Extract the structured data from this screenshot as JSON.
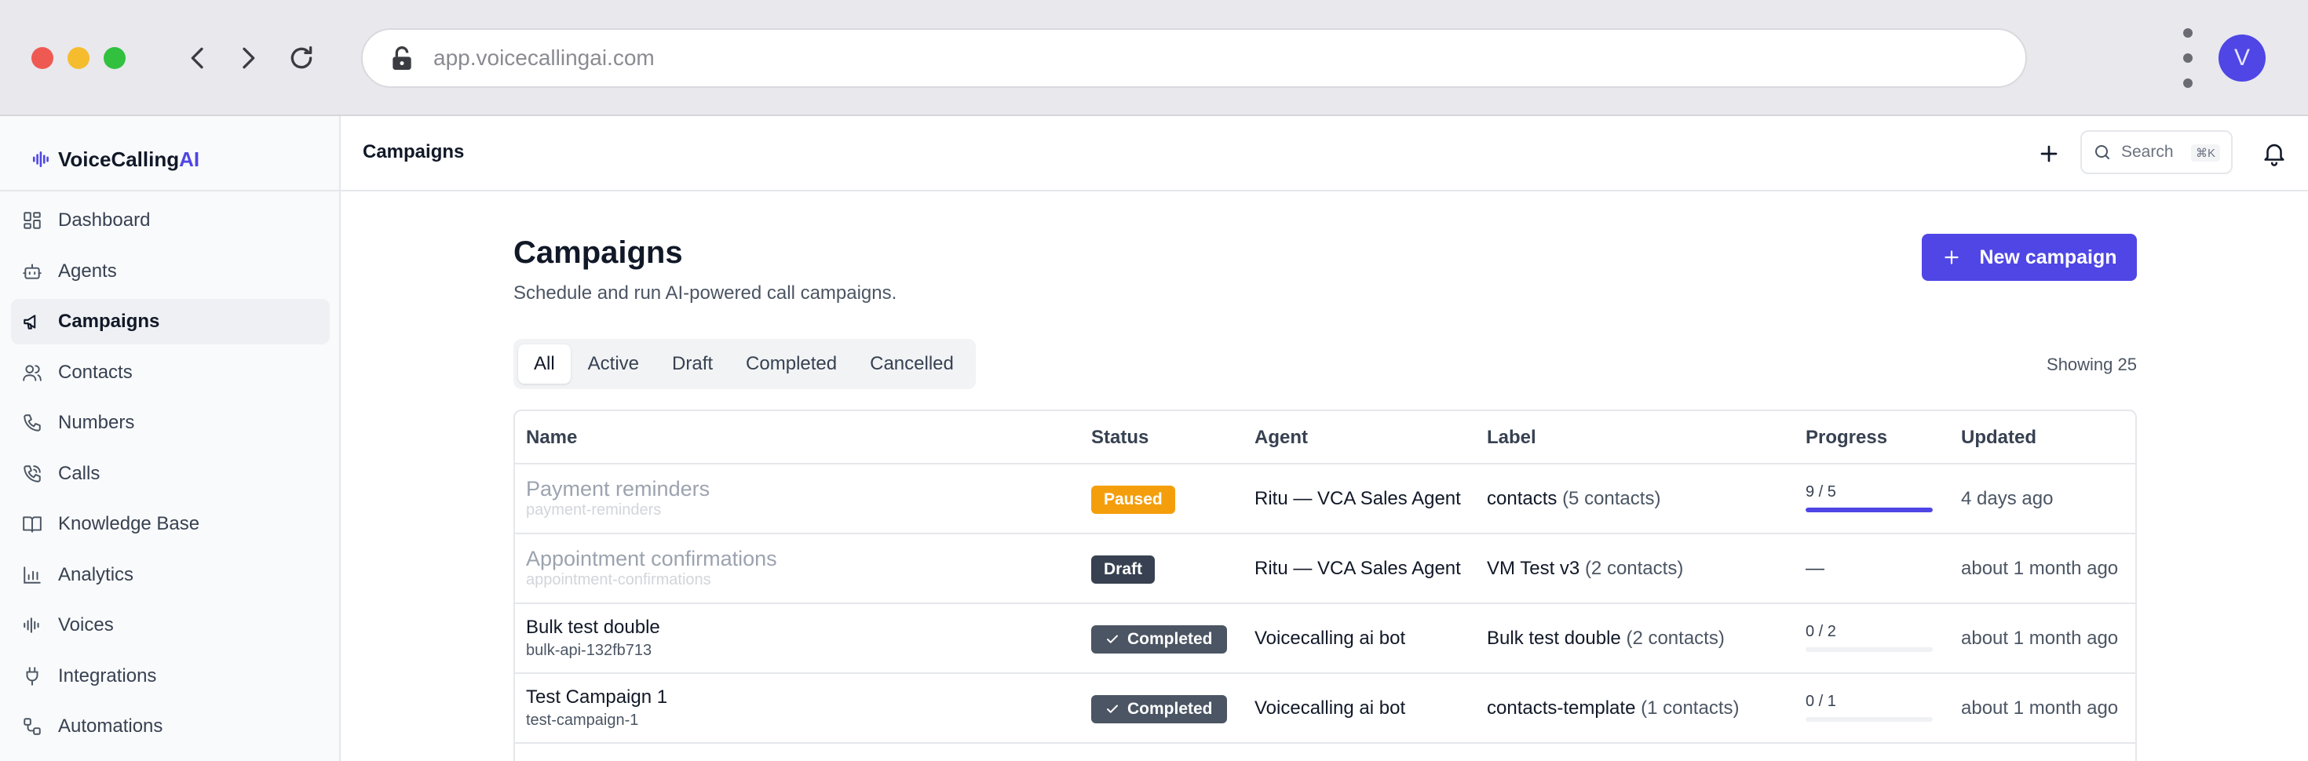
{
  "browser": {
    "url": "app.voicecallingai.com",
    "profile_initial": "V"
  },
  "brand": {
    "name_main": "VoiceCalling",
    "name_accent": "AI",
    "accent_color": "#4f46e5"
  },
  "sidebar": {
    "items": [
      {
        "label": "Dashboard",
        "icon": "dashboard-icon"
      },
      {
        "label": "Agents",
        "icon": "bot-icon"
      },
      {
        "label": "Campaigns",
        "icon": "megaphone-icon",
        "active": true
      },
      {
        "label": "Contacts",
        "icon": "users-icon"
      },
      {
        "label": "Numbers",
        "icon": "phone-icon"
      },
      {
        "label": "Calls",
        "icon": "phone-call-icon"
      },
      {
        "label": "Knowledge Base",
        "icon": "book-icon"
      },
      {
        "label": "Analytics",
        "icon": "bar-chart-icon"
      },
      {
        "label": "Voices",
        "icon": "audio-waveform-icon"
      },
      {
        "label": "Integrations",
        "icon": "plug-icon"
      },
      {
        "label": "Automations",
        "icon": "workflow-icon"
      }
    ]
  },
  "topbar": {
    "breadcrumb": "Campaigns",
    "search_label": "Search",
    "search_shortcut": "⌘K"
  },
  "main": {
    "title": "Campaigns",
    "subtitle": "Schedule and run AI-powered call campaigns.",
    "new_button": "New campaign",
    "tabs": [
      "All",
      "Active",
      "Draft",
      "Completed",
      "Cancelled"
    ],
    "active_tab": "All",
    "showing": "Showing 25"
  },
  "table": {
    "headers": {
      "name": "Name",
      "status": "Status",
      "agent": "Agent",
      "label": "Label",
      "progress": "Progress",
      "updated": "Updated"
    },
    "rows": [
      {
        "name": "Payment reminders",
        "slug": "payment-reminders",
        "status": "Paused",
        "agent": "Ritu — VCA Sales Agent",
        "label": "contacts",
        "label_count": "(5 contacts)",
        "progress_text": "9 / 5",
        "progress_fraction": 1.0,
        "updated": "4 days ago"
      },
      {
        "name": "Appointment confirmations",
        "slug": "appointment-confirmations",
        "status": "Draft",
        "agent": "Ritu — VCA Sales Agent",
        "label": "VM Test v3",
        "label_count": "(2 contacts)",
        "progress_text": "—",
        "updated": "about 1 month ago"
      },
      {
        "name": "Bulk test double",
        "slug": "bulk-api-132fb713",
        "status": "Completed",
        "agent": "Voicecalling ai bot",
        "label": "Bulk test double",
        "label_count": "(2 contacts)",
        "progress_text": "0 / 2",
        "progress_fraction": 0.0,
        "updated": "about 1 month ago"
      },
      {
        "name": "Test Campaign 1",
        "slug": "test-campaign-1",
        "status": "Completed",
        "agent": "Voicecalling ai bot",
        "label": "contacts-template",
        "label_count": "(1 contacts)",
        "progress_text": "0 / 1",
        "progress_fraction": 0.0,
        "updated": "about 1 month ago"
      }
    ]
  },
  "colors": {
    "paused": "#f59e0b",
    "draft": "#374151",
    "completed": "#4b5563",
    "primary": "#4f46e5"
  }
}
